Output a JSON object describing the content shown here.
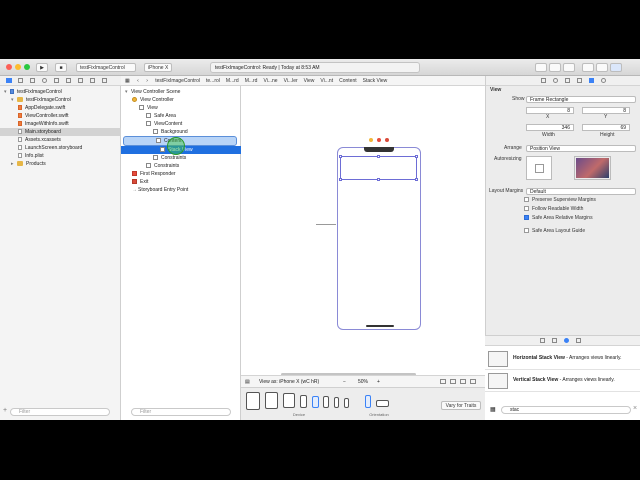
{
  "toolbar": {
    "scheme_target": "testFixImageControl",
    "device": "iPhone X",
    "status": "testFixImageControl: Ready | Today at 8:53 AM"
  },
  "jumpbar": {
    "crumbs": [
      "testFixImageControl",
      "te...rol",
      "M...rd",
      "M...rd",
      "Vi...ne",
      "Vi...ler",
      "View",
      "Vi...nt",
      "Content",
      "Stack View"
    ]
  },
  "navigator": {
    "items": [
      {
        "label": "testFixImageControl",
        "kind": "project",
        "indent": 0,
        "selected": false
      },
      {
        "label": "testFixImageControl",
        "kind": "folder",
        "indent": 1,
        "selected": false
      },
      {
        "label": "AppDelegate.swift",
        "kind": "swift",
        "indent": 2,
        "selected": false
      },
      {
        "label": "ViewController.swift",
        "kind": "swift",
        "indent": 2,
        "selected": false
      },
      {
        "label": "ImageWithInfo.swift",
        "kind": "swift",
        "indent": 2,
        "selected": false
      },
      {
        "label": "Main.storyboard",
        "kind": "file",
        "indent": 2,
        "selected": true
      },
      {
        "label": "Assets.xcassets",
        "kind": "assets",
        "indent": 2,
        "selected": false
      },
      {
        "label": "LaunchScreen.storyboard",
        "kind": "file",
        "indent": 2,
        "selected": false
      },
      {
        "label": "Info.plist",
        "kind": "file",
        "indent": 2,
        "selected": false
      },
      {
        "label": "Products",
        "kind": "folder",
        "indent": 1,
        "selected": false
      }
    ],
    "filter_placeholder": "Filter"
  },
  "outline": {
    "items": [
      {
        "label": "View Controller Scene",
        "kind": "tri",
        "indent": 0
      },
      {
        "label": "View Controller",
        "kind": "vc",
        "indent": 1
      },
      {
        "label": "View",
        "kind": "box",
        "indent": 2
      },
      {
        "label": "Safe Area",
        "kind": "box",
        "indent": 3
      },
      {
        "label": "ViewContent",
        "kind": "box",
        "indent": 3
      },
      {
        "label": "Background",
        "kind": "box",
        "indent": 4
      },
      {
        "label": "Content",
        "kind": "box",
        "indent": 4
      },
      {
        "label": "Stack View",
        "kind": "box",
        "indent": 5
      },
      {
        "label": "Constraints",
        "kind": "box",
        "indent": 4
      },
      {
        "label": "Constraints",
        "kind": "box",
        "indent": 3
      },
      {
        "label": "First Responder",
        "kind": "fr",
        "indent": 1
      },
      {
        "label": "Exit",
        "kind": "ex",
        "indent": 1
      },
      {
        "label": "Storyboard Entry Point",
        "kind": "arrow",
        "indent": 1
      }
    ],
    "filter_placeholder": "Filter"
  },
  "canvas": {
    "view_as": "View as: iPhone X (wC hR)",
    "zoom": "50%",
    "vary_for_traits": "Vary for Traits",
    "device_label": "Device",
    "orientation_label": "Orientation"
  },
  "inspector": {
    "section": "View",
    "show_label": "Show",
    "show_value": "Frame Rectangle",
    "x_val": "8",
    "y_val": "8",
    "x_label": "X",
    "y_label": "Y",
    "w_val": "346",
    "h_val": "69",
    "width_label": "Width",
    "height_label": "Height",
    "arrange_label": "Arrange",
    "arrange_value": "Position View",
    "autoresizing_label": "Autoresizing",
    "layout_margins_label": "Layout Margins",
    "layout_margins_value": "Default",
    "checkboxes": [
      {
        "label": "Preserve Superview Margins",
        "checked": false
      },
      {
        "label": "Follow Readable Width",
        "checked": false
      },
      {
        "label": "Safe Area Relative Margins",
        "checked": true
      },
      {
        "label": "Safe Area Layout Guide",
        "checked": false
      }
    ]
  },
  "library": {
    "items": [
      {
        "title": "Horizontal Stack View",
        "desc": " - Arranges views linearly."
      },
      {
        "title": "Vertical Stack View",
        "desc": " - Arranges views linearly."
      }
    ],
    "filter_value": "stac"
  }
}
